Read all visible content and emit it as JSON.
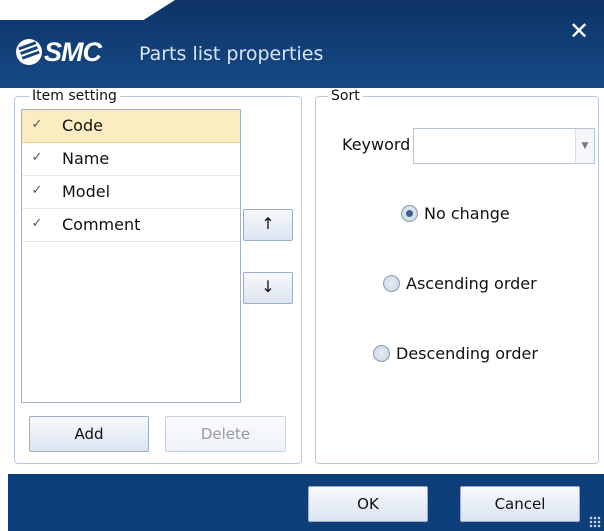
{
  "window": {
    "brand": "SMC",
    "title": "Parts list properties",
    "close_glyph": "✕"
  },
  "item_setting": {
    "legend": "Item setting",
    "items": [
      {
        "label": "Code",
        "checked": true,
        "selected": true
      },
      {
        "label": "Name",
        "checked": true,
        "selected": false
      },
      {
        "label": "Model",
        "checked": true,
        "selected": false
      },
      {
        "label": "Comment",
        "checked": true,
        "selected": false
      }
    ],
    "check_glyph": "✓",
    "move_up_glyph": "↑",
    "move_down_glyph": "↓",
    "add_label": "Add",
    "delete_label": "Delete"
  },
  "sort": {
    "legend": "Sort",
    "keyword_label": "Keyword",
    "keyword_value": "",
    "options": [
      {
        "label": "No change",
        "selected": true
      },
      {
        "label": "Ascending order",
        "selected": false
      },
      {
        "label": "Descending order",
        "selected": false
      }
    ]
  },
  "footer": {
    "ok_label": "OK",
    "cancel_label": "Cancel"
  }
}
